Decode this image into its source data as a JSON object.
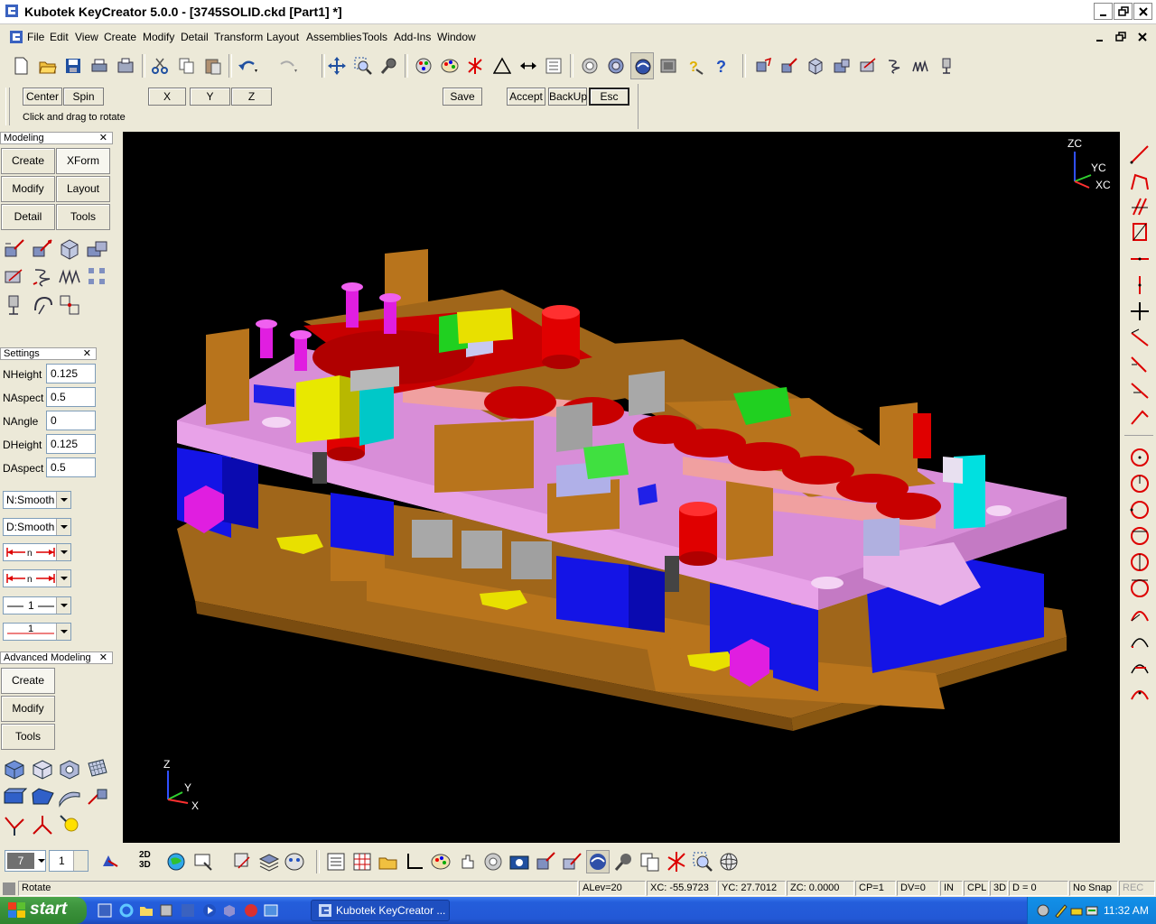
{
  "window": {
    "title": "Kubotek KeyCreator 5.0.0 - [3745SOLID.ckd [Part1] *]",
    "app_icon": "keycreator-logo-icon"
  },
  "menu": [
    "File",
    "Edit",
    "View",
    "Create",
    "Modify",
    "Detail",
    "Transform",
    "Layout",
    "Assemblies",
    "Tools",
    "Add-Ins",
    "Window"
  ],
  "prompt": {
    "buttons": {
      "center": "Center",
      "spin": "Spin",
      "x": "X",
      "y": "Y",
      "z": "Z",
      "save": "Save",
      "accept": "Accept",
      "backup": "BackUp",
      "esc": "Esc"
    },
    "message": "Click and drag to rotate"
  },
  "modeling_panel": {
    "title": "Modeling",
    "tabs": {
      "create": "Create",
      "xform": "XForm",
      "modify": "Modify",
      "layout": "Layout",
      "detail": "Detail",
      "tools": "Tools"
    }
  },
  "settings_panel": {
    "title": "Settings",
    "fields": [
      {
        "label": "NHeight",
        "value": "0.125"
      },
      {
        "label": "NAspect",
        "value": "0.5"
      },
      {
        "label": "NAngle",
        "value": "0"
      },
      {
        "label": "DHeight",
        "value": "0.125"
      },
      {
        "label": "DAspect",
        "value": "0.5"
      }
    ],
    "dropdowns": {
      "nsmooth": "N:Smooth",
      "dsmooth": "D:Smooth",
      "style1": "1",
      "style2": "1"
    }
  },
  "advanced_panel": {
    "title": "Advanced Modeling",
    "buttons": {
      "create": "Create",
      "modify": "Modify",
      "tools": "Tools"
    }
  },
  "viewport": {
    "axes_top": {
      "z": "ZC",
      "y": "YC",
      "x": "XC"
    },
    "axes_bottom": {
      "z": "Z",
      "y": "Y",
      "x": "X"
    }
  },
  "bottom_toolbar": {
    "view_number": "7",
    "layer": "1",
    "mode_2d": "2D",
    "mode_3d": "3D"
  },
  "status": {
    "mode": "Rotate",
    "alev": "ALev=20",
    "xc": "XC: -55.9723",
    "yc": "YC: 27.7012",
    "zc": "ZC: 0.0000",
    "cp": "CP=1",
    "dv": "DV=0",
    "units": "IN",
    "cpl": "CPL",
    "dim": "3D",
    "depth": "D = 0",
    "snap": "No Snap",
    "rec": "REC"
  },
  "taskbar": {
    "start": "start",
    "task": "Kubotek KeyCreator ...",
    "clock": "11:32 AM"
  },
  "colors": {
    "viewport_bg": "#000000",
    "plate_pink": "#e89ae8",
    "block_blue": "#1414e6",
    "base_brown": "#b8741c",
    "part_red": "#c80000",
    "xp_blue": "#245edb",
    "start_green": "#3c933c"
  }
}
